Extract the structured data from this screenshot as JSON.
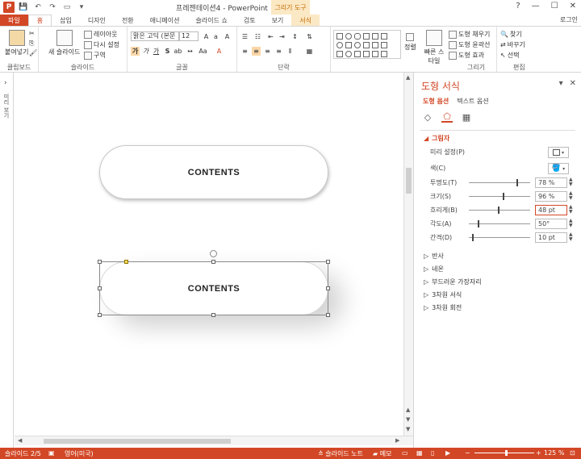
{
  "titlebar": {
    "title": "프레젠테이션4 - PowerPoint",
    "drawing_tools": "그리기 도구",
    "app_icon": "P",
    "window_buttons": [
      "?",
      "—",
      "☐",
      "✕"
    ]
  },
  "tabs": [
    "파일",
    "홈",
    "삽입",
    "디자인",
    "전환",
    "애니메이션",
    "슬라이드 쇼",
    "검토",
    "보기",
    "서식"
  ],
  "login": "로그인",
  "ribbon": {
    "clipboard": {
      "label": "클립보드",
      "paste": "붙여넣기"
    },
    "slides": {
      "label": "슬라이드",
      "new_slide": "새 슬라이드",
      "layout": "레이아웃",
      "reset": "다시 설정",
      "section": "구역"
    },
    "font": {
      "label": "글꼴",
      "font_name": "맑은 고딕 (본문",
      "font_size": "12"
    },
    "paragraph": {
      "label": "단락"
    },
    "drawing": {
      "label": "그리기",
      "arrange": "정렬",
      "quick_styles": "빠른 스타일",
      "fill": "도형 채우기",
      "outline": "도형 윤곽선",
      "effects": "도형 효과"
    },
    "editing": {
      "label": "편집",
      "find": "찾기",
      "replace": "바꾸기",
      "select": "선택"
    }
  },
  "left_strip": {
    "label": "미리 보기"
  },
  "slide": {
    "shape1_text": "CONTENTS",
    "shape2_text": "CONTENTS"
  },
  "pane": {
    "title": "도형 서식",
    "tab_shape": "도형 옵션",
    "tab_text": "텍스트 옵션",
    "section_shadow": "그림자",
    "rows": [
      {
        "label": "미리 설정(P)"
      },
      {
        "label": "색(C)"
      },
      {
        "label": "투명도(T)",
        "value": "78 %",
        "level": 0.78
      },
      {
        "label": "크기(S)",
        "value": "96 %",
        "level": 0.55
      },
      {
        "label": "흐리게(B)",
        "value": "48 pt",
        "level": 0.48
      },
      {
        "label": "각도(A)",
        "value": "50°",
        "level": 0.14
      },
      {
        "label": "간격(D)",
        "value": "10 pt",
        "level": 0.05
      }
    ],
    "collapsed_sections": [
      "반사",
      "네온",
      "부드러운 가장자리",
      "3차원 서식",
      "3차원 회전"
    ]
  },
  "status": {
    "slide_info": "슬라이드 2/5",
    "language": "영어(미국)",
    "notes": "슬라이드 노트",
    "comments": "메모",
    "zoom": "125 %"
  },
  "colors": {
    "accent": "#d24726",
    "format_tab": "#fbe8c4"
  }
}
